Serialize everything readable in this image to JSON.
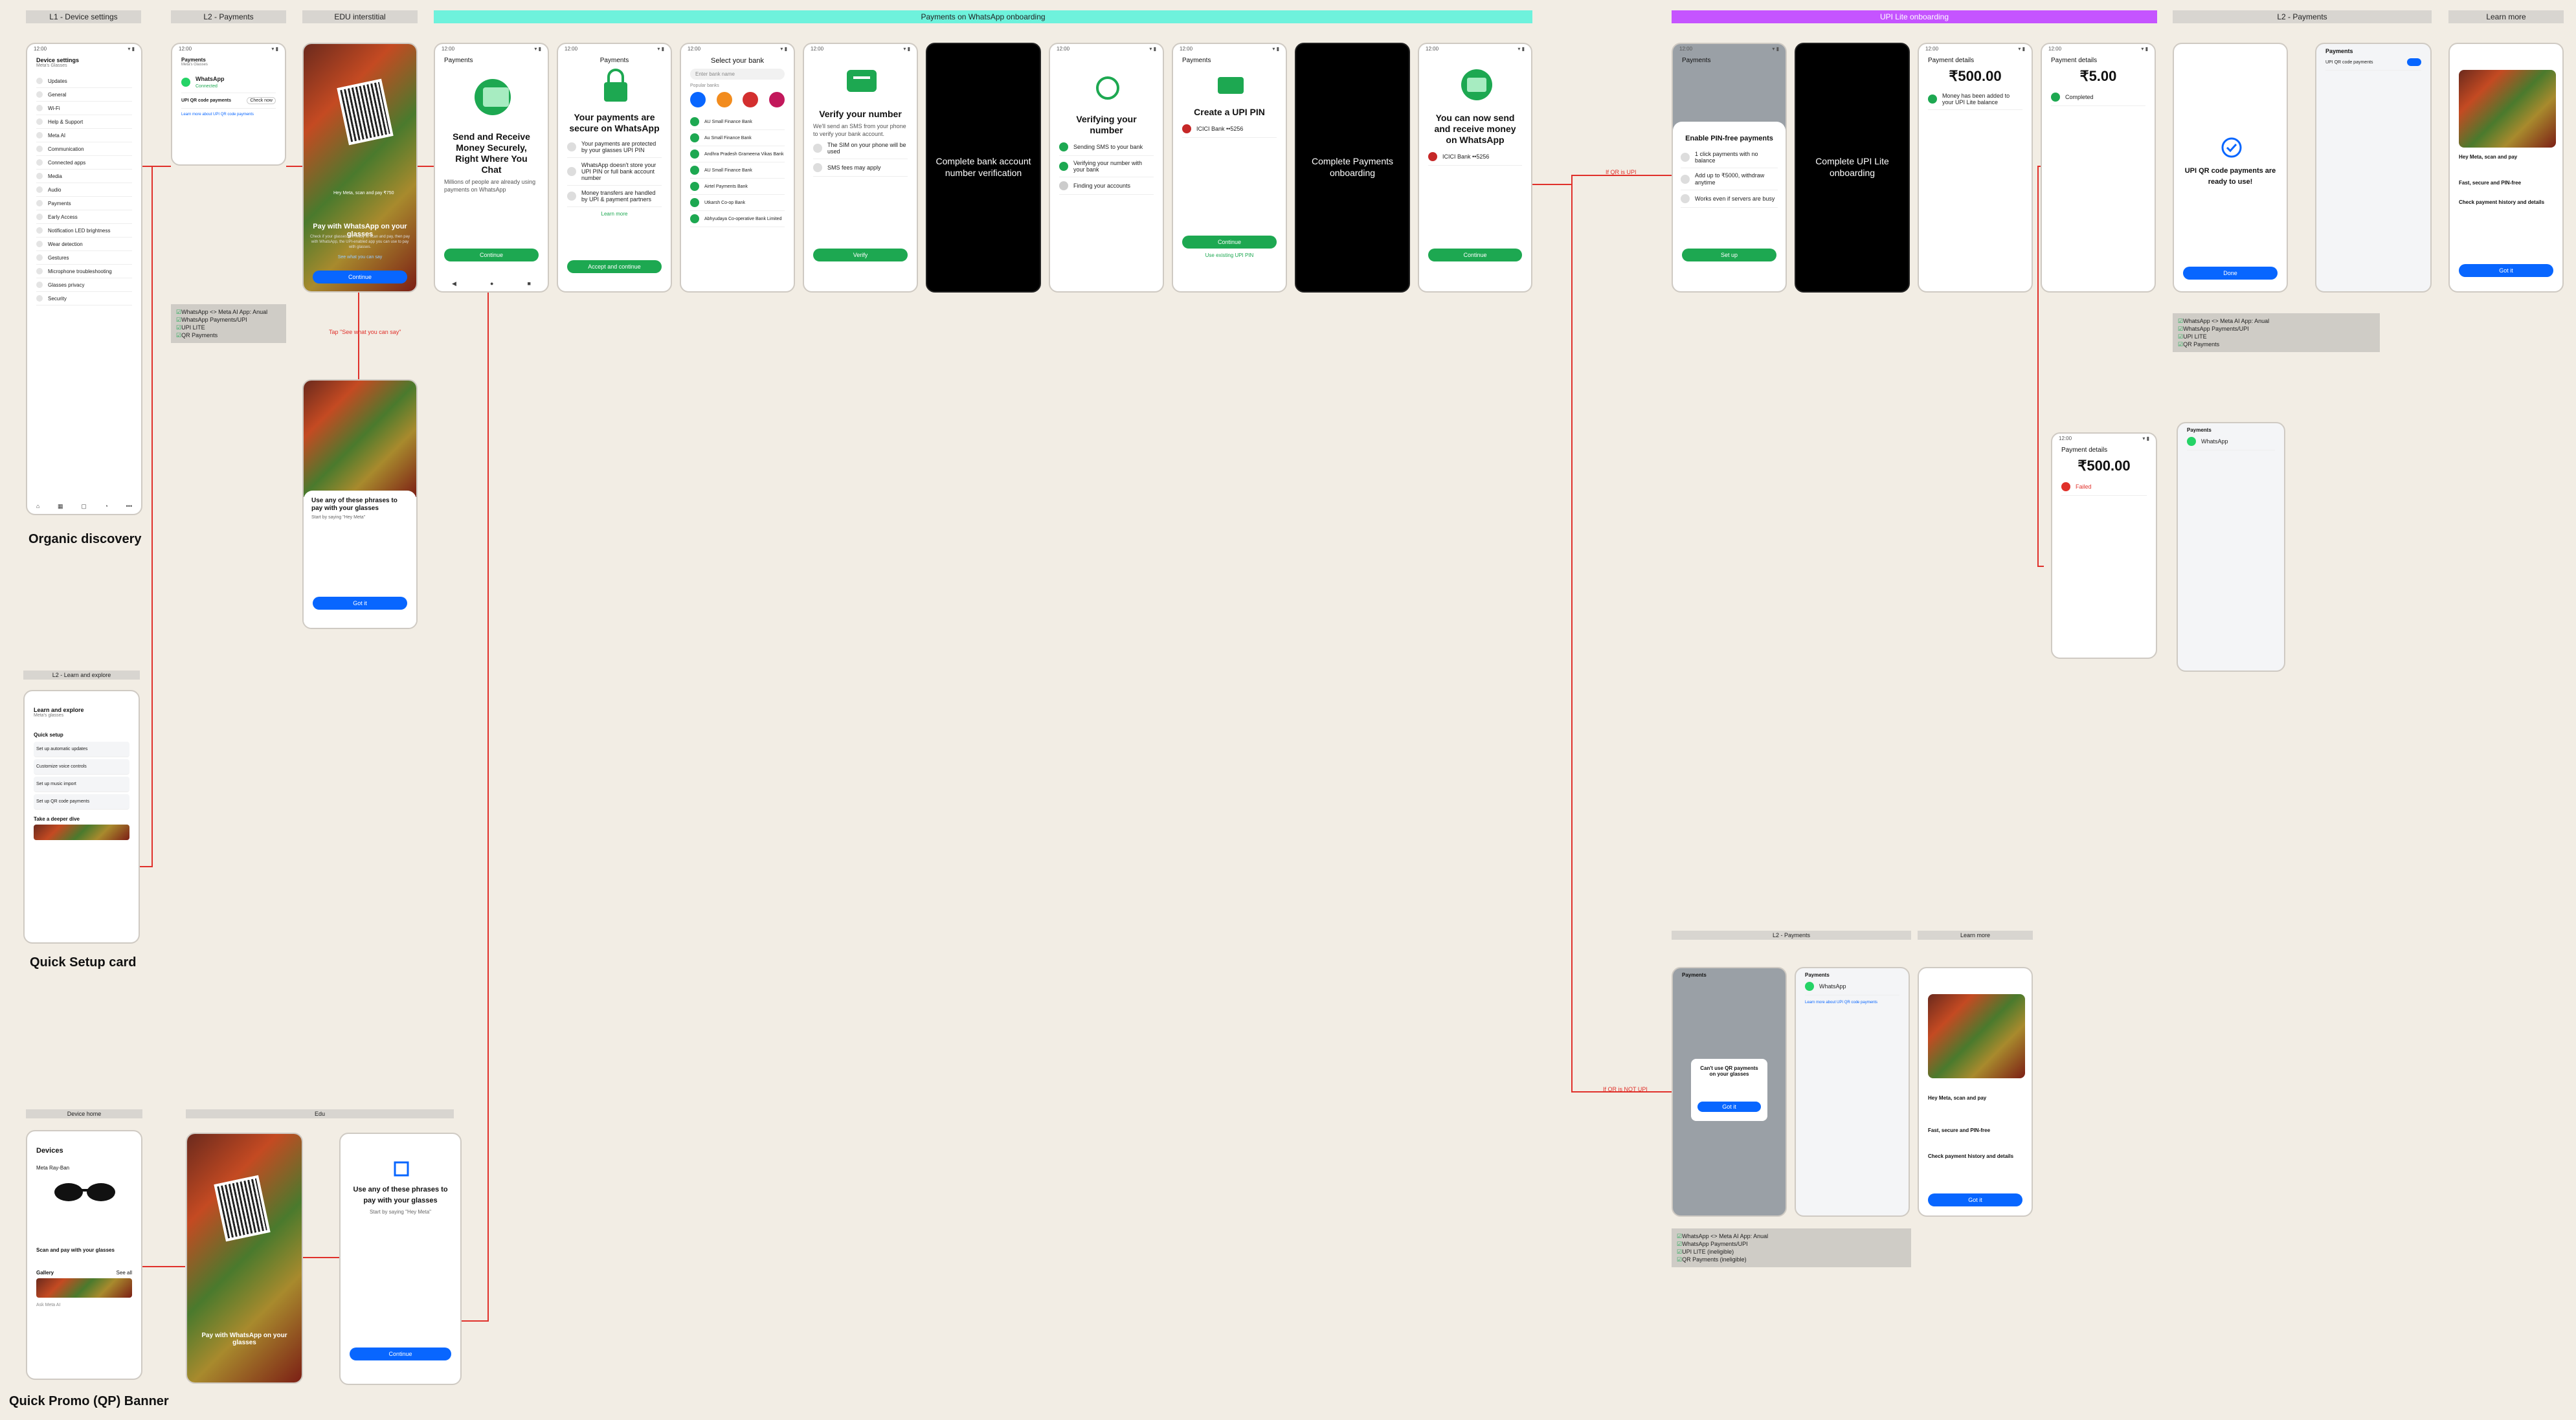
{
  "headers": {
    "device_settings": "L1 - Device settings",
    "l2_payments": "L2 - Payments",
    "edu": "EDU interstitial",
    "onboarding": "Payments on WhatsApp onboarding",
    "upi_lite": "UPI Lite onboarding",
    "l2_payments_2": "L2 - Payments",
    "learn_more": "Learn more",
    "learn_explore": "L2 - Learn and explore",
    "device_home": "Device home",
    "edu2": "Edu",
    "l2_payments_3": "L2 - Payments",
    "learn_more_2": "Learn more"
  },
  "captions": {
    "organic": "Organic discovery",
    "quick_setup": "Quick Setup card",
    "quick_promo": "Quick Promo (QP) Banner"
  },
  "notes": {
    "tap_see_what": "Tap \"See what you can say\"",
    "if_upi_lite": "If QR is UPI",
    "if_not_upi_lite": "If QR is NOT UPI"
  },
  "device_settings": {
    "title": "Device settings",
    "subtitle": "Meta's Glasses",
    "items": [
      "Updates",
      "General",
      "Wi-Fi",
      "Help & Support",
      "Meta AI",
      "Communication",
      "Connected apps",
      "Media",
      "Audio",
      "Payments",
      "Early Access",
      "Notification LED brightness",
      "Wear detection",
      "Gestures",
      "Microphone troubleshooting",
      "Glasses privacy",
      "Security"
    ]
  },
  "l2_payments": {
    "title": "Payments",
    "subtitle": "Meta's Glasses",
    "app": "WhatsApp",
    "app_status": "Connected",
    "upi_title": "UPI QR code payments",
    "check_now": "Check now",
    "learn_link": "Learn more about UPI QR code payments"
  },
  "checklist1": [
    "WhatsApp <> Meta AI App: Anual",
    "WhatsApp Payments/UPI",
    "UPI LITE",
    "QR Payments"
  ],
  "edu": {
    "hey_meta": "Hey Meta, scan and pay ₹750",
    "title": "Pay with WhatsApp on your glasses",
    "body": "Check if your glasses are ready to scan and pay, then pay with WhatsApp, the UPI-enabled app you can use to pay with glasses.",
    "link": "See what you can say",
    "button": "Continue",
    "phrases_title": "Use any of these phrases to pay with your glasses",
    "phrases_sub": "Start by saying \"Hey Meta\"",
    "got_it": "Got it"
  },
  "onboarding": {
    "s1_title": "Payments",
    "s1_heading": "Send and Receive Money Securely, Right Where You Chat",
    "s1_body": "Millions of people are already using payments on WhatsApp",
    "s1_button": "Continue",
    "s2_title": "Payments",
    "s2_heading": "Your payments are secure on WhatsApp",
    "s2_b1": "Your payments are protected by your glasses UPI PIN",
    "s2_b2": "WhatsApp doesn't store your UPI PIN or full bank account number",
    "s2_b3": "Money transfers are handled by UPI & payment partners",
    "s2_link": "Learn more",
    "s2_button": "Accept and continue",
    "s3_title": "Select your bank",
    "s3_search": "Enter bank name",
    "s3_popular": "Popular banks",
    "s3_banks": [
      "AU Small Finance Bank",
      "Au Small Finance Bank",
      "Andhra Pradesh Grameena Vikas Bank",
      "AU Small Finance Bank",
      "Airtel Payments Bank",
      "Utkarsh Co-op Bank",
      "Abhyudaya Co-operative Bank Limited"
    ],
    "s4_heading": "Verify your number",
    "s4_body": "We'll send an SMS from your phone to verify your bank account.",
    "s4_i1": "The SIM on your phone will be used",
    "s4_i2": "SMS fees may apply",
    "s4_button": "Verify",
    "s5_msg": "Complete bank account number verification",
    "s6_heading": "Verifying your number",
    "s6_i1": "Sending SMS to your bank",
    "s6_i2": "Verifying your number with your bank",
    "s6_i3": "Finding your accounts",
    "s7_title": "Payments",
    "s7_heading": "Create a UPI PIN",
    "s7_bank": "ICICI Bank ••5256",
    "s7_button": "Continue",
    "s7_link": "Use existing UPI PIN",
    "s8_msg": "Complete Payments onboarding",
    "s9_heading": "You can now send and receive money on WhatsApp",
    "s9_bank": "ICICI Bank ••5256",
    "s9_button": "Continue"
  },
  "upi_lite": {
    "u1_title": "Payments",
    "u1_heading": "Enable PIN-free payments",
    "u1_i1": "1 click payments with no balance",
    "u1_i2": "Add up to ₹5000, withdraw anytime",
    "u1_i3": "Works even if servers are busy",
    "u1_button": "Set up",
    "u2_msg": "Complete UPI Lite onboarding",
    "u3_title": "Payment details",
    "u3_amount": "₹500.00",
    "u3_status": "Money has been added to your UPI Lite balance",
    "u4_title": "Payment details",
    "u4_amount": "₹5.00",
    "u4_status": "Completed",
    "u5_heading": "UPI QR code payments are ready to use!",
    "u5_button": "Done",
    "u6_title": "Payments",
    "u7_hey": "Hey Meta, scan and pay",
    "u7_i1": "Fast, secure and PIN-free",
    "u7_i2": "Check payment history and details",
    "u7_button": "Got it"
  },
  "checklist2": [
    "WhatsApp <> Meta AI App: Anual",
    "WhatsApp Payments/UPI",
    "UPI LITE",
    "QR Payments"
  ],
  "checklist3": [
    "WhatsApp <> Meta AI App: Anual",
    "WhatsApp Payments/UPI",
    "UPI LITE (ineligible)",
    "QR Payments (ineligible)"
  ],
  "payment_fail": {
    "title": "Payment details",
    "amount": "₹500.00",
    "status": "Failed"
  },
  "not_upi": {
    "l2_title": "Payments",
    "dialog_title": "Can't use QR payments on your glasses",
    "dialog_button": "Got it"
  },
  "learn_explore": {
    "title": "Learn and explore",
    "subtitle": "Meta's glasses",
    "quick_setup": "Quick setup",
    "items": [
      "Set up automatic updates",
      "Customize voice controls",
      "Set up music import",
      "Set up QR code payments"
    ],
    "tip": "Take a deeper dive"
  },
  "device_home": {
    "title": "Devices",
    "device": "Meta Ray-Ban",
    "promo": "Scan and pay with your glasses",
    "gallery": "Gallery",
    "see_all": "See all",
    "ask": "Ask Meta AI"
  }
}
